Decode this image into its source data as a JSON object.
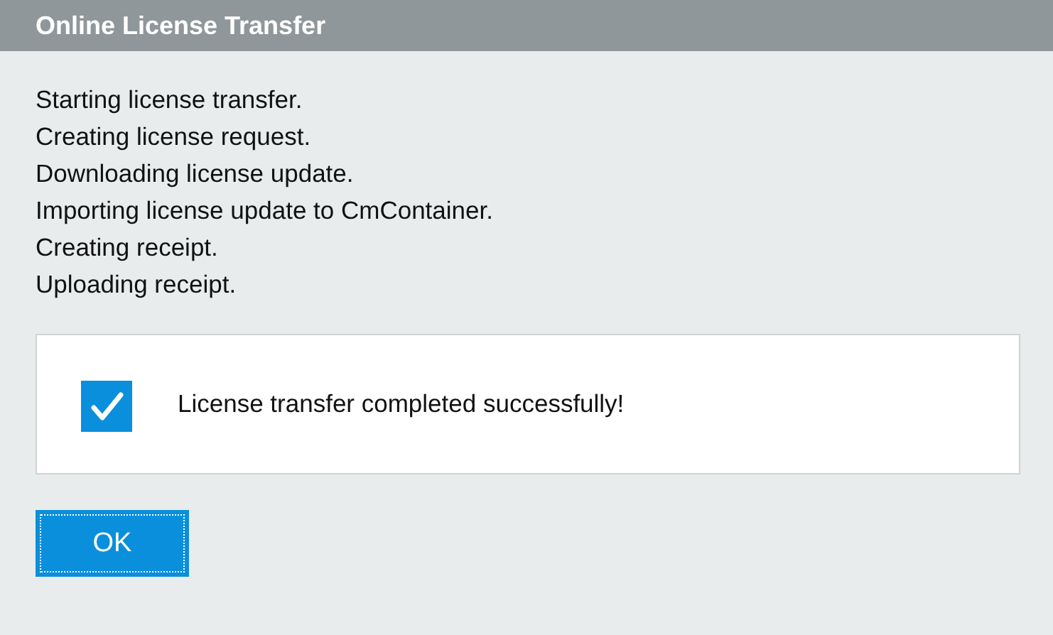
{
  "window": {
    "title": "Online License Transfer"
  },
  "log": [
    "Starting license transfer.",
    "Creating license request.",
    "Downloading license update.",
    "Importing license update to CmContainer.",
    "Creating receipt.",
    "Uploading receipt."
  ],
  "result": {
    "kind": "success",
    "message": "License transfer completed successfully!"
  },
  "buttons": [
    {
      "label": "OK",
      "focused": true
    }
  ]
}
